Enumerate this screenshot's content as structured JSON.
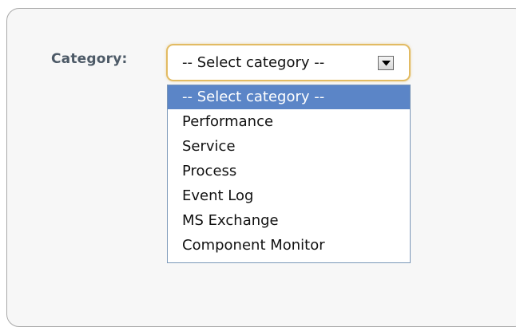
{
  "form": {
    "category_label": "Category:",
    "select": {
      "selected_value": "-- Select category --",
      "options": [
        "-- Select category --",
        "Performance",
        "Service",
        "Process",
        "Event Log",
        "MS Exchange",
        "Component Monitor"
      ],
      "highlighted_option": "-- Select category --"
    }
  },
  "colors": {
    "focus_border": "#e2bb63",
    "highlight": "#5b85c7",
    "dropdown_border": "#7a97b8"
  },
  "icons": {
    "dropdown_arrow": "chevron-down-icon"
  }
}
